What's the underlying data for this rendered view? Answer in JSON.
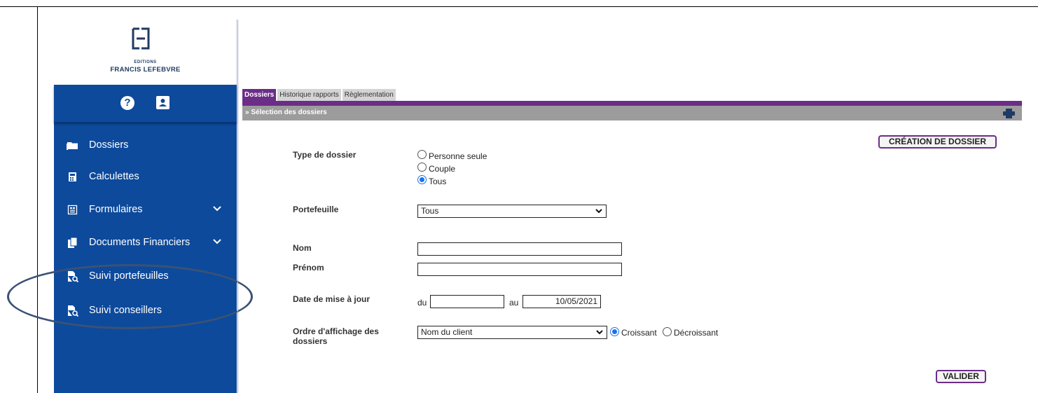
{
  "brand": {
    "small": "EDITIONS",
    "name": "FRANCIS LEFEBVRE"
  },
  "sidebar": {
    "top_icons": [
      "help-icon",
      "contact-icon"
    ],
    "items": [
      {
        "label": "Dossiers",
        "icon": "folder-icon"
      },
      {
        "label": "Calculettes",
        "icon": "calculator-icon"
      },
      {
        "label": "Formulaires",
        "icon": "form-icon",
        "expandable": true
      },
      {
        "label": "Documents Financiers",
        "icon": "documents-icon",
        "expandable": true
      },
      {
        "label": "Suivi portefeuilles",
        "icon": "file-search-icon"
      },
      {
        "label": "Suivi conseillers",
        "icon": "file-search-icon"
      }
    ]
  },
  "tabs": [
    {
      "label": "Dossiers",
      "active": true
    },
    {
      "label": "Historique rapports",
      "active": false
    },
    {
      "label": "Règlementation",
      "active": false
    }
  ],
  "section": {
    "title": "» Sélection des dossiers"
  },
  "buttons": {
    "create": "CRÉATION DE DOSSIER",
    "submit": "VALIDER"
  },
  "form": {
    "type_label": "Type de dossier",
    "type_options": [
      {
        "label": "Personne seule",
        "checked": false
      },
      {
        "label": "Couple",
        "checked": false
      },
      {
        "label": "Tous",
        "checked": true
      }
    ],
    "portfolio_label": "Portefeuille",
    "portfolio_value": "Tous",
    "nom_label": "Nom",
    "nom_value": "",
    "prenom_label": "Prénom",
    "prenom_value": "",
    "date_label": "Date de mise à jour",
    "date_from_label": "du",
    "date_from_value": "",
    "date_to_label": "au",
    "date_to_value": "10/05/2021",
    "order_label_line1": "Ordre d'affichage des",
    "order_label_line2": "dossiers",
    "order_value": "Nom du client",
    "order_options": [
      {
        "label": "Croissant",
        "checked": true
      },
      {
        "label": "Décroissant",
        "checked": false
      }
    ]
  },
  "colors": {
    "sidebar": "#0d4a9c",
    "accent": "#6b2d87",
    "bar": "#9c9c9c",
    "radio": "#1a73e8"
  }
}
